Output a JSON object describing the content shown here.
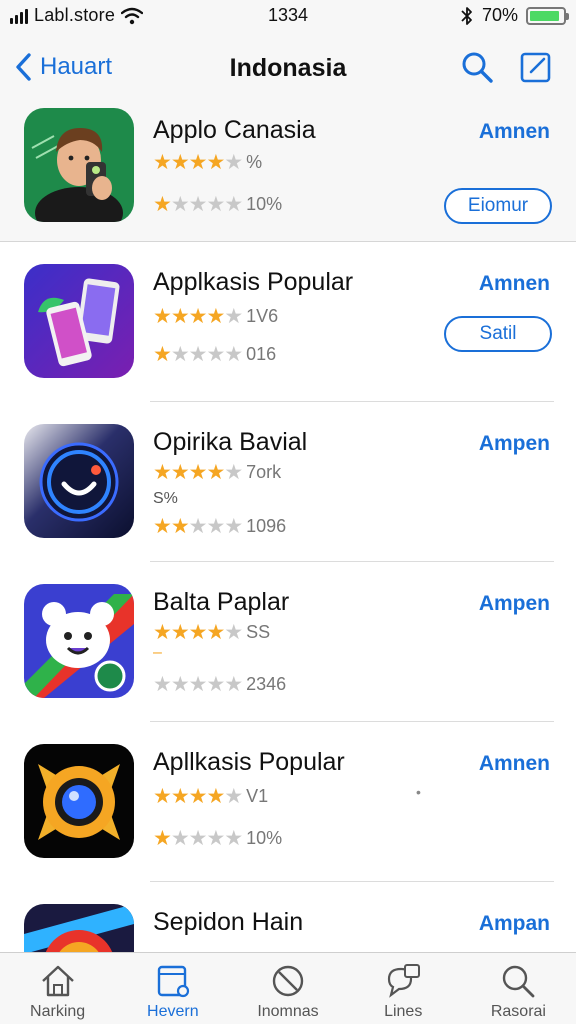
{
  "status_bar": {
    "carrier": "Labl.store",
    "time": "1334",
    "battery_percent": "70%",
    "battery_level": 0.9,
    "icons": [
      "signal-icon",
      "wifi-icon",
      "bluetooth-icon",
      "battery-icon"
    ]
  },
  "nav": {
    "back_label": "Hauart",
    "title": "Indonasia",
    "icons": [
      "chevron-left-icon",
      "search-icon",
      "compose-icon"
    ]
  },
  "apps": [
    {
      "name": "Applo Canasia",
      "action": "Amnen",
      "rating1": {
        "stars": 4,
        "text": "%"
      },
      "rating2": {
        "stars": 1,
        "text": "10%"
      },
      "button": "Eiomur",
      "icon": "person-phone-icon"
    },
    {
      "name": "Applkasis Popular",
      "action": "Amnen",
      "rating1": {
        "stars": 4,
        "text": "1V6"
      },
      "rating2": {
        "stars": 1,
        "text": "016"
      },
      "button": "Satil",
      "icon": "phones-icon"
    },
    {
      "name": "Opirika Bavial",
      "action": "Ampen",
      "rating1": {
        "stars": 4,
        "text": "7ork"
      },
      "extra": "S%",
      "rating2": {
        "stars": 2,
        "text": "1096"
      },
      "icon": "smile-lens-icon"
    },
    {
      "name": "Balta Paplar",
      "action": "Ampen",
      "rating1": {
        "stars": 4,
        "text": "SS"
      },
      "extra": "–",
      "rating2": {
        "stars": 0,
        "text": "2346"
      },
      "icon": "bear-icon"
    },
    {
      "name": "Apllkasis Popular",
      "action": "Amnen",
      "rating1": {
        "stars": 4,
        "text": "V1"
      },
      "rating2": {
        "stars": 1,
        "text": "10%"
      },
      "icon": "camera-lens-icon"
    },
    {
      "name": "Sepidon Hain",
      "action": "Ampan",
      "icon": "target-icon"
    }
  ],
  "tabs": [
    {
      "label": "Narking",
      "icon": "home-icon",
      "active": false
    },
    {
      "label": "Hevern",
      "icon": "calendar-icon",
      "active": true
    },
    {
      "label": "Inomnas",
      "icon": "no-sign-icon",
      "active": false
    },
    {
      "label": "Lines",
      "icon": "chat-icon",
      "active": false
    },
    {
      "label": "Rasorai",
      "icon": "search-icon",
      "active": false
    }
  ],
  "colors": {
    "accent": "#1a6fd8",
    "star": "#f5a623",
    "star_empty": "#c8c8c8",
    "bar_bg": "#f7f7f7"
  }
}
